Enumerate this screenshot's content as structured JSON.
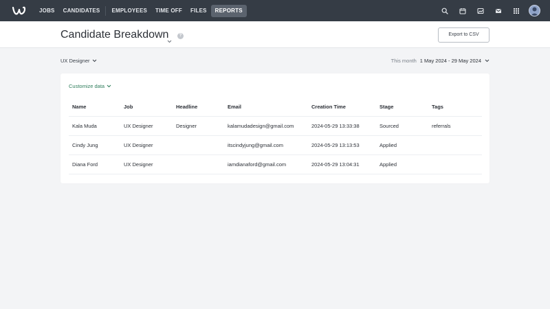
{
  "nav": {
    "items": [
      {
        "label": "JOBS",
        "active": false
      },
      {
        "label": "CANDIDATES",
        "active": false
      },
      {
        "label": "EMPLOYEES",
        "active": false
      },
      {
        "label": "TIME OFF",
        "active": false
      },
      {
        "label": "FILES",
        "active": false
      },
      {
        "label": "REPORTS",
        "active": true
      }
    ],
    "icons": [
      "search-icon",
      "calendar-icon",
      "image-icon",
      "mail-icon",
      "apps-grid-icon",
      "avatar"
    ]
  },
  "header": {
    "title": "Candidate Breakdown",
    "export_label": "Export to CSV"
  },
  "filters": {
    "job": "UX Designer",
    "date_label": "This month",
    "date_range": "1 May 2024 - 29 May 2024"
  },
  "card": {
    "customize_label": "Customize data",
    "columns": [
      "Name",
      "Job",
      "Headline",
      "Email",
      "Creation Time",
      "Stage",
      "Tags"
    ],
    "rows": [
      {
        "name": "Kala Muda",
        "job": "UX Designer",
        "headline": "Designer",
        "email": "kalamudadesign@gmail.com",
        "time": "2024-05-29 13:33:38",
        "stage": "Sourced",
        "tags": "referrals"
      },
      {
        "name": "Cindy Jung",
        "job": "UX Designer",
        "headline": "",
        "email": "itscindyjung@gmail.com",
        "time": "2024-05-29 13:13:53",
        "stage": "Applied",
        "tags": ""
      },
      {
        "name": "Diana Ford",
        "job": "UX Designer",
        "headline": "",
        "email": "iamdianaford@gmail.com",
        "time": "2024-05-29 13:04:31",
        "stage": "Applied",
        "tags": ""
      }
    ]
  },
  "colors": {
    "nav_bg": "#353c45",
    "accent_green": "#2e7d5b",
    "page_bg": "#f3f4f6"
  }
}
